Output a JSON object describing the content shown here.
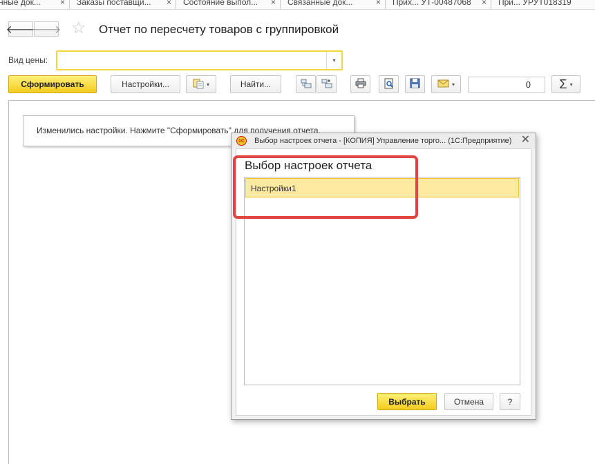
{
  "tabs": [
    {
      "label": "нные док..."
    },
    {
      "label": "Заказы поставщи..."
    },
    {
      "label": "Состояние выпол..."
    },
    {
      "label": "Связанные док..."
    },
    {
      "label": "Прих... УТ-00487068"
    },
    {
      "label": "При... УРУТ018319"
    }
  ],
  "tab_close_glyph": "×",
  "nav": {
    "back_glyph": "🡐",
    "forward_glyph": "🡒"
  },
  "page": {
    "title": "Отчет по пересчету товаров с группировкой",
    "favorite_glyph": "☆"
  },
  "price_type": {
    "label": "Вид цены:",
    "value": "",
    "dropdown_glyph": "▾"
  },
  "toolbar": {
    "generate_label": "Сформировать",
    "settings_label": "Настройки...",
    "find_label": "Найти...",
    "number_value": "0",
    "sum_glyph": "Σ",
    "caret_glyph": "▾"
  },
  "notice": {
    "text": "Изменились настройки. Нажмите \"Сформировать\" для получения отчета."
  },
  "dialog": {
    "logo_text": "1С",
    "title": "Выбор настроек отчета - [КОПИЯ] Управление торго...  (1С:Предприятие)",
    "close_glyph": "✕",
    "heading": "Выбор настроек отчета",
    "items": [
      {
        "label": "Настройки1"
      }
    ],
    "select_label": "Выбрать",
    "cancel_label": "Отмена",
    "help_label": "?"
  },
  "colors": {
    "accent_yellow": "#f3cc1e",
    "selection": "#fde9a0",
    "annotation_red": "#e04545"
  }
}
